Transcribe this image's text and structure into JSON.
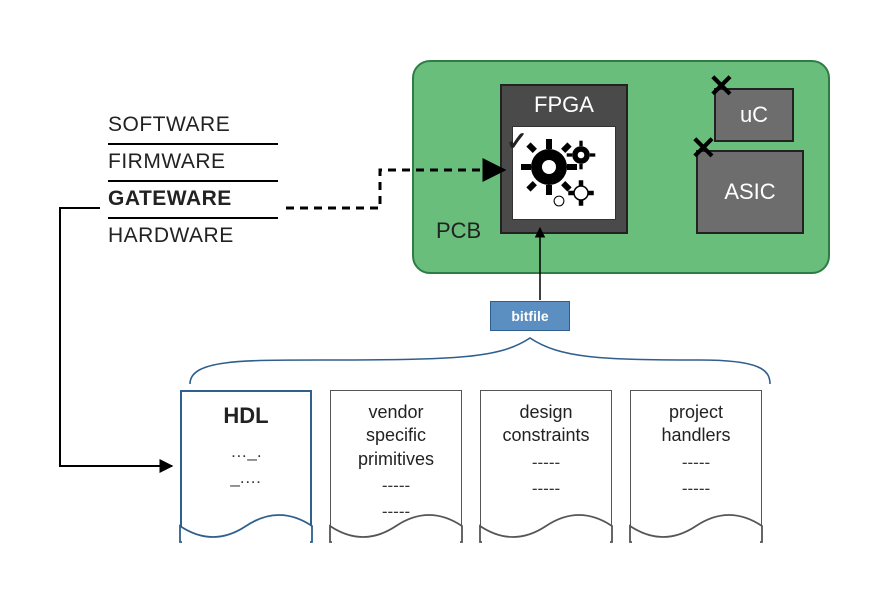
{
  "wares": {
    "items": [
      "SOFTWARE",
      "FIRMWARE",
      "GATEWARE",
      "HARDWARE"
    ],
    "bold_index": 2
  },
  "pcb": {
    "label": "PCB",
    "fpga": {
      "label": "FPGA",
      "check": "✓"
    },
    "uc": {
      "label": "uC",
      "x": "✕"
    },
    "asic": {
      "label": "ASIC",
      "x": "✕"
    }
  },
  "bitfile": {
    "label": "bitfile"
  },
  "docs": [
    {
      "title": "HDL",
      "lines": [
        "…_.",
        "_.…"
      ],
      "hdl": true
    },
    {
      "title": "vendor specific primitives",
      "lines": [
        "-----",
        "-----"
      ]
    },
    {
      "title": "design constraints",
      "lines": [
        "-----",
        "-----"
      ]
    },
    {
      "title": "project handlers",
      "lines": [
        "-----",
        "-----"
      ]
    }
  ]
}
